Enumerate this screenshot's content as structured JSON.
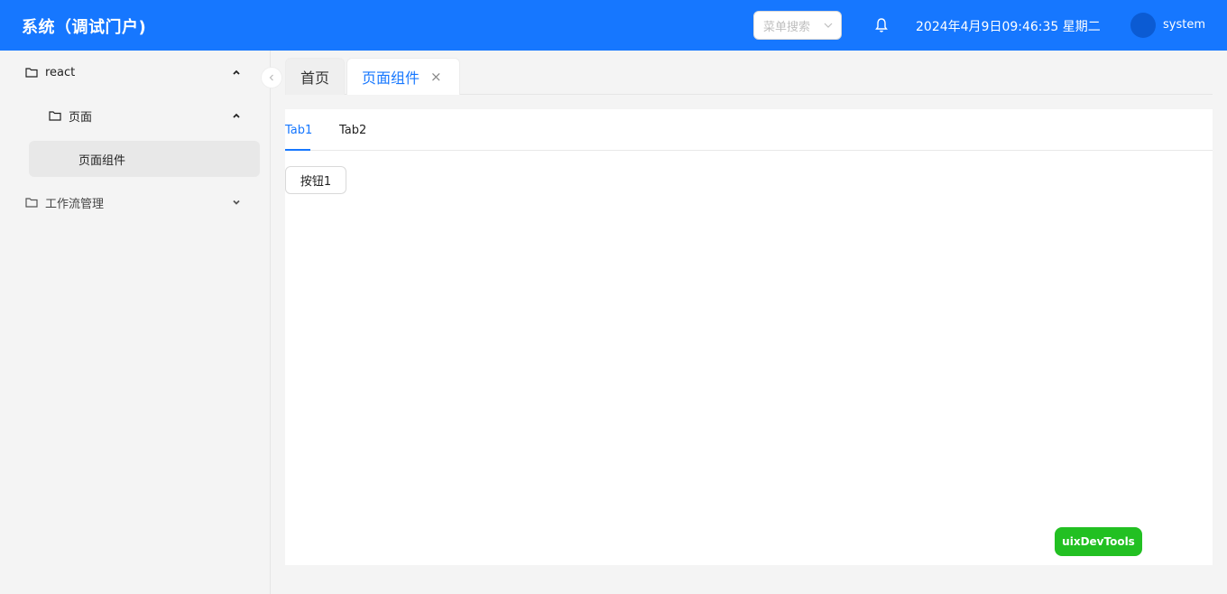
{
  "header": {
    "title": "系统（调试门户)",
    "menu_search_placeholder": "菜单搜索",
    "datetime": "2024年4月9日09:46:35 星期二",
    "username": "system"
  },
  "sidebar": {
    "items": [
      {
        "label": "react",
        "expanded": true
      },
      {
        "label": "页面",
        "expanded": true
      },
      {
        "label": "页面组件",
        "selected": true
      },
      {
        "label": "工作流管理",
        "expanded": false
      }
    ]
  },
  "page_tabs": [
    {
      "label": "首页"
    },
    {
      "label": "页面组件",
      "active": true,
      "close": "×"
    }
  ],
  "content": {
    "tabs": [
      {
        "label": "Tab1",
        "active": true
      },
      {
        "label": "Tab2"
      }
    ],
    "button_label": "按钮1"
  },
  "devtools": {
    "label": "uixDevTools"
  },
  "colors": {
    "primary": "#1677ff",
    "devtools": "#22c022"
  }
}
